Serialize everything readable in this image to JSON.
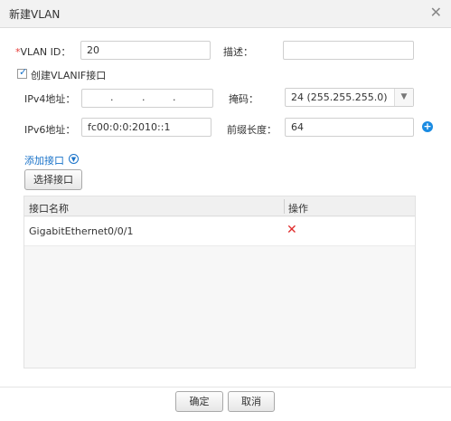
{
  "dialog": {
    "title": "新建VLAN",
    "close_icon": "close-icon"
  },
  "form": {
    "vlan_id": {
      "required_mark": "*",
      "label": "VLAN ID：",
      "value": "20"
    },
    "description": {
      "label": "描述：",
      "value": ""
    },
    "create_vlanif": {
      "label": "创建VLANIF接口",
      "checked": true
    },
    "ipv4": {
      "label": "IPv4地址：",
      "value": ".      .      .",
      "dots": [
        ".",
        ".",
        "."
      ]
    },
    "mask": {
      "label": "掩码：",
      "value": "24 (255.255.255.0)"
    },
    "ipv6": {
      "label": "IPv6地址：",
      "value": "fc00:0:0:2010::1"
    },
    "prefix": {
      "label": "前缀长度：",
      "value": "64"
    }
  },
  "ports": {
    "add_link": "添加接口",
    "select_button": "选择接口",
    "columns": [
      "接口名称",
      "操作"
    ],
    "rows": [
      {
        "name": "GigabitEthernet0/0/1",
        "action_icon": "delete-icon"
      }
    ]
  },
  "footer": {
    "ok": "确定",
    "cancel": "取消"
  },
  "colors": {
    "accent": "#1a73c9",
    "delete": "#e02d2d",
    "required": "#e53935"
  }
}
